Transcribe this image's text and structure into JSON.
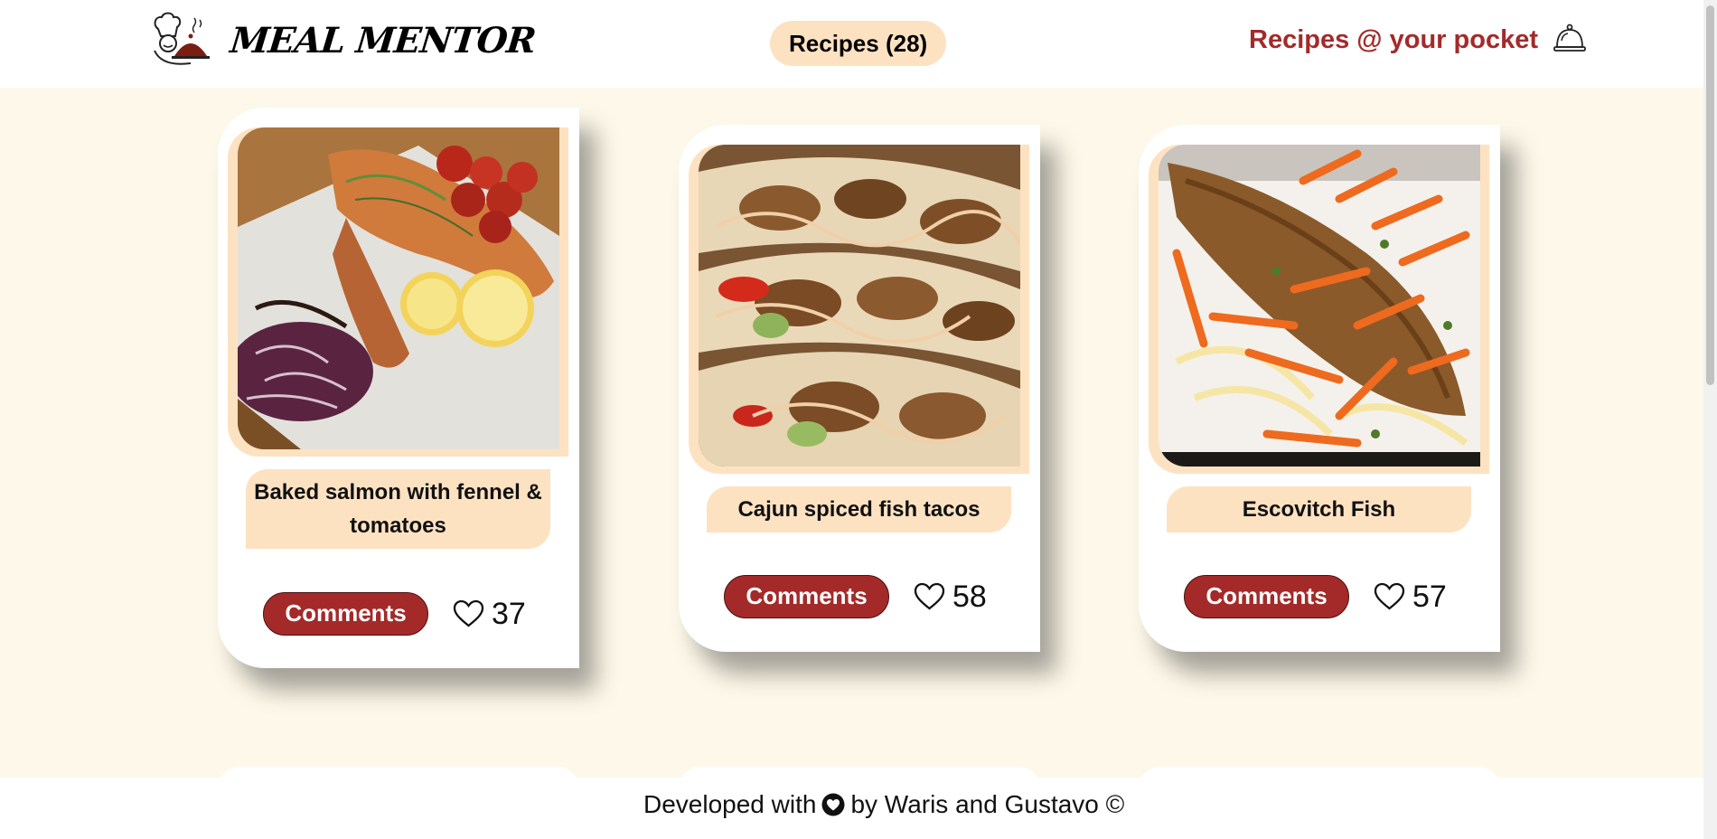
{
  "header": {
    "brand": "MEAL MENTOR",
    "recipes_count_label": "Recipes (28)",
    "tagline": "Recipes @ your pocket",
    "logo_icon": "chef-cloche-icon",
    "bell_icon": "service-bell-icon"
  },
  "recipes": [
    {
      "title": "Baked salmon with fennel & tomatoes",
      "comments_label": "Comments",
      "likes": "37"
    },
    {
      "title": "Cajun spiced fish tacos",
      "comments_label": "Comments",
      "likes": "58"
    },
    {
      "title": "Escovitch Fish",
      "comments_label": "Comments",
      "likes": "57"
    }
  ],
  "footer": {
    "before": "Developed with",
    "after": "by Waris and Gustavo ©"
  },
  "colors": {
    "accent": "#a42a2a",
    "badge": "#fde2c2",
    "background": "#fdf8e9"
  }
}
